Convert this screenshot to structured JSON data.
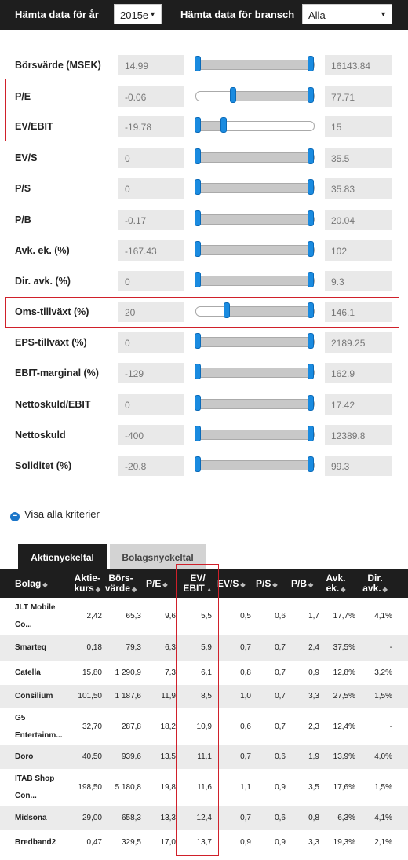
{
  "header": {
    "year_label": "Hämta data för år",
    "year_value": "2015e",
    "industry_label": "Hämta data för bransch",
    "industry_value": "Alla"
  },
  "filters": [
    {
      "label": "Börsvärde (MSEK)",
      "min": "14.99",
      "max": "16143.84",
      "low": 0.0,
      "high": 1.0
    },
    {
      "label": "P/E",
      "min": "-0.06",
      "max": "77.71",
      "low": 0.31,
      "high": 1.0
    },
    {
      "label": "EV/EBIT",
      "min": "-19.78",
      "max": "15",
      "low": 0.0,
      "high": 0.24
    },
    {
      "label": "EV/S",
      "min": "0",
      "max": "35.5",
      "low": 0.0,
      "high": 1.0
    },
    {
      "label": "P/S",
      "min": "0",
      "max": "35.83",
      "low": 0.0,
      "high": 1.0
    },
    {
      "label": "P/B",
      "min": "-0.17",
      "max": "20.04",
      "low": 0.0,
      "high": 1.0
    },
    {
      "label": "Avk. ek. (%)",
      "min": "-167.43",
      "max": "102",
      "low": 0.0,
      "high": 1.0
    },
    {
      "label": "Dir. avk. (%)",
      "min": "0",
      "max": "9.3",
      "low": 0.0,
      "high": 1.0
    },
    {
      "label": "Oms-tillväxt (%)",
      "min": "20",
      "max": "146.1",
      "low": 0.25,
      "high": 1.0
    },
    {
      "label": "EPS-tillväxt (%)",
      "min": "0",
      "max": "2189.25",
      "low": 0.0,
      "high": 1.0
    },
    {
      "label": "EBIT-marginal (%)",
      "min": "-129",
      "max": "162.9",
      "low": 0.0,
      "high": 1.0
    },
    {
      "label": "Nettoskuld/EBIT",
      "min": "0",
      "max": "17.42",
      "low": 0.0,
      "high": 1.0
    },
    {
      "label": "Nettoskuld",
      "min": "-400",
      "max": "12389.8",
      "low": 0.0,
      "high": 1.0
    },
    {
      "label": "Soliditet (%)",
      "min": "-20.8",
      "max": "99.3",
      "low": 0.0,
      "high": 1.0
    }
  ],
  "show_all": "Visa alla kriterier",
  "tabs": [
    "Aktienyckeltal",
    "Bolagsnyckeltal"
  ],
  "table": {
    "columns": [
      {
        "line1": "Bolag",
        "line2": ""
      },
      {
        "line1": "Aktie-",
        "line2": "kurs"
      },
      {
        "line1": "Börs-",
        "line2": "värde"
      },
      {
        "line1": "P/E",
        "line2": ""
      },
      {
        "line1": "EV/",
        "line2": "EBIT"
      },
      {
        "line1": "EV/S",
        "line2": ""
      },
      {
        "line1": "P/S",
        "line2": ""
      },
      {
        "line1": "P/B",
        "line2": ""
      },
      {
        "line1": "Avk.",
        "line2": "ek."
      },
      {
        "line1": "Dir.",
        "line2": "avk."
      }
    ],
    "rows": [
      {
        "name1": "JLT Mobile",
        "name2": "Co...",
        "cells": [
          "2,42",
          "65,3",
          "9,6",
          "5,5",
          "0,5",
          "0,6",
          "1,7",
          "17,7%",
          "4,1%"
        ]
      },
      {
        "name1": "Smarteq",
        "name2": "",
        "cells": [
          "0,18",
          "79,3",
          "6,3",
          "5,9",
          "0,7",
          "0,7",
          "2,4",
          "37,5%",
          "-"
        ]
      },
      {
        "name1": "Catella",
        "name2": "",
        "cells": [
          "15,80",
          "1 290,9",
          "7,3",
          "6,1",
          "0,8",
          "0,7",
          "0,9",
          "12,8%",
          "3,2%"
        ]
      },
      {
        "name1": "Consilium",
        "name2": "",
        "cells": [
          "101,50",
          "1 187,6",
          "11,9",
          "8,5",
          "1,0",
          "0,7",
          "3,3",
          "27,5%",
          "1,5%"
        ]
      },
      {
        "name1": "G5",
        "name2": "Entertainm...",
        "cells": [
          "32,70",
          "287,8",
          "18,2",
          "10,9",
          "0,6",
          "0,7",
          "2,3",
          "12,4%",
          "-"
        ]
      },
      {
        "name1": "Doro",
        "name2": "",
        "cells": [
          "40,50",
          "939,6",
          "13,5",
          "11,1",
          "0,7",
          "0,6",
          "1,9",
          "13,9%",
          "4,0%"
        ]
      },
      {
        "name1": "ITAB Shop",
        "name2": "Con...",
        "cells": [
          "198,50",
          "5 180,8",
          "19,8",
          "11,6",
          "1,1",
          "0,9",
          "3,5",
          "17,6%",
          "1,5%"
        ]
      },
      {
        "name1": "Midsona",
        "name2": "",
        "cells": [
          "29,00",
          "658,3",
          "13,3",
          "12,4",
          "0,7",
          "0,6",
          "0,8",
          "6,3%",
          "4,1%"
        ]
      },
      {
        "name1": "Bredband2",
        "name2": "",
        "cells": [
          "0,47",
          "329,5",
          "17,0",
          "13,7",
          "0,9",
          "0,9",
          "3,3",
          "19,3%",
          "2,1%"
        ]
      }
    ]
  },
  "colors": {
    "accent": "#1a8be0",
    "highlight": "#d0202a",
    "header_bg": "#1e1e1e"
  }
}
